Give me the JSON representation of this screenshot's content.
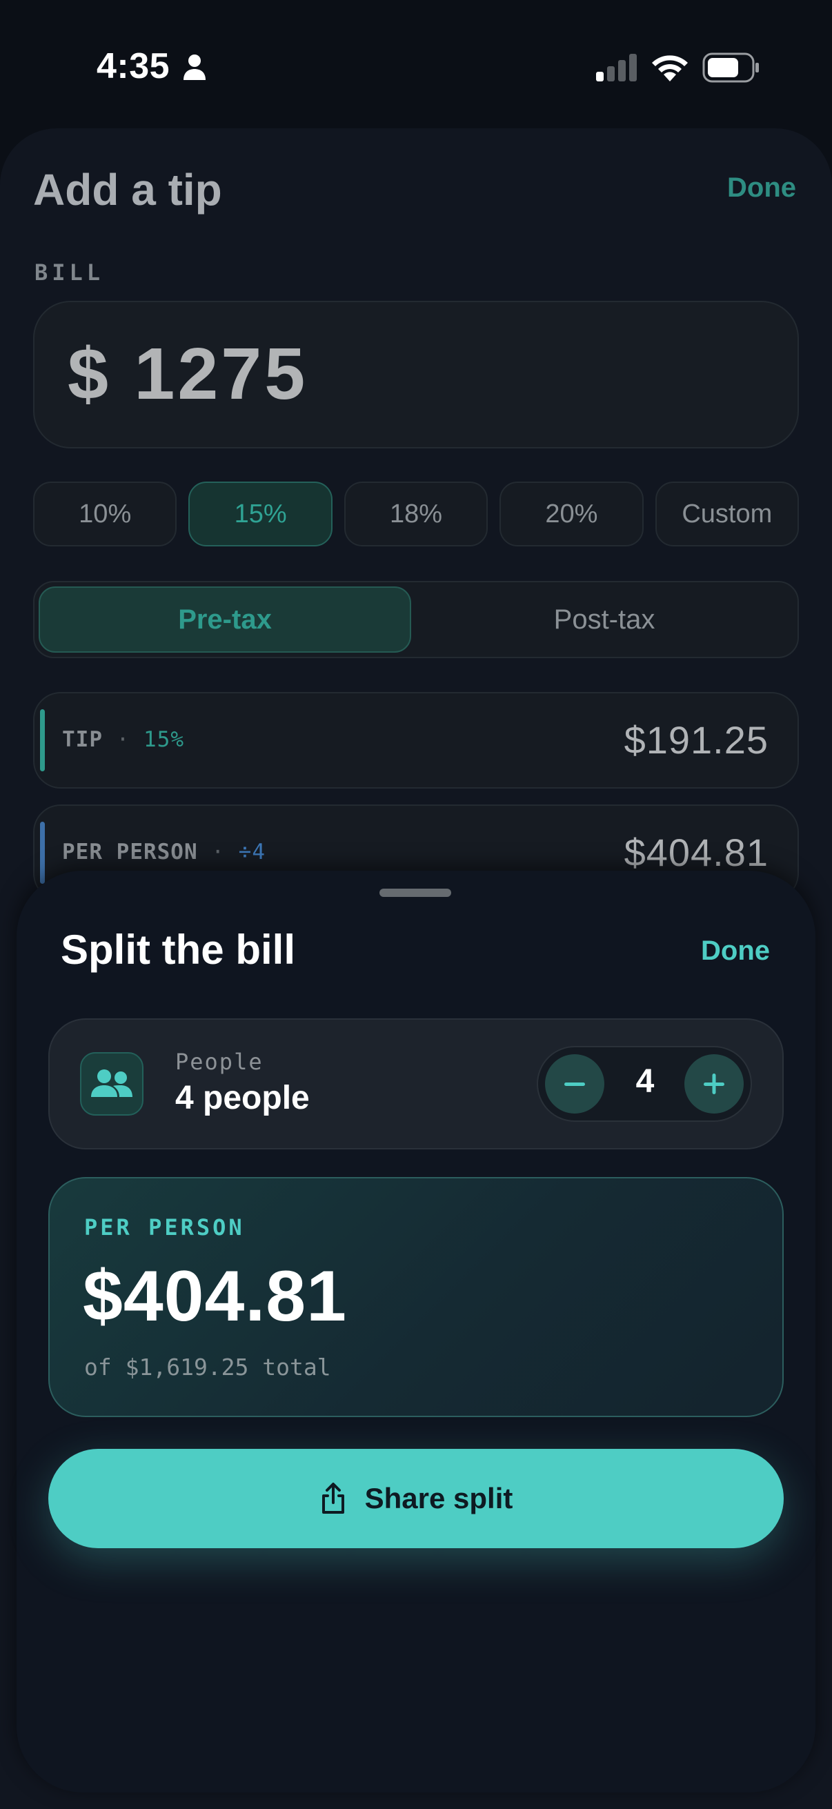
{
  "status_bar": {
    "time": "4:35",
    "icons": [
      "person-icon",
      "cellular-signal-icon",
      "wifi-icon",
      "battery-icon"
    ]
  },
  "tip_sheet": {
    "title": "Add a tip",
    "done_label": "Done",
    "bill_label": "BILL",
    "bill_amount": "$ 1275",
    "tip_options": [
      "10%",
      "15%",
      "18%",
      "20%",
      "Custom"
    ],
    "selected_tip": "15%",
    "tax_modes": [
      "Pre-tax",
      "Post-tax"
    ],
    "selected_tax_mode": "Pre-tax",
    "rows": {
      "tip": {
        "label": "TIP",
        "sub": "15%",
        "value": "$191.25"
      },
      "per_person": {
        "label": "PER PERSON",
        "sub": "÷4",
        "value": "$404.81"
      }
    }
  },
  "split_sheet": {
    "title": "Split the bill",
    "done_label": "Done",
    "people_label": "People",
    "people_value": "4 people",
    "people_count": "4",
    "per_person_label": "PER PERSON",
    "per_person_value": "$404.81",
    "total_text": "of $1,619.25 total",
    "share_label": "Share split"
  },
  "colors": {
    "accent": "#4ecdc4",
    "background": "#0b0f16",
    "tip_accent_bar": "#2e9a8c",
    "per_person_accent_bar": "#3d6fa8"
  }
}
